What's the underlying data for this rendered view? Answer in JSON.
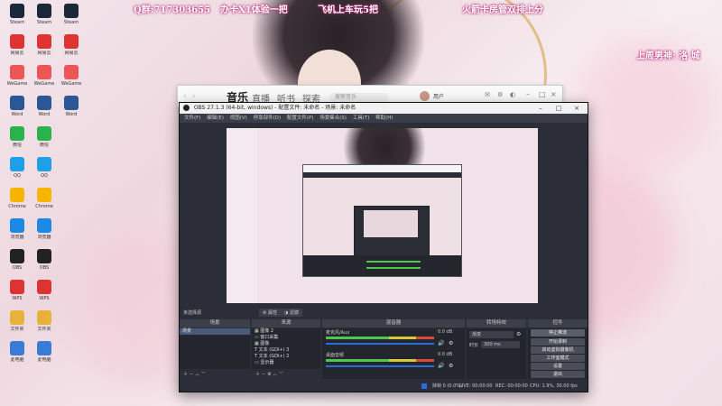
{
  "overlay": {
    "qq_group": "Q群:717303655",
    "promo_line1": "办卡X1体验一把",
    "promo_line2": "飞机上车玩5把",
    "promo_right": "火箭卡房管双排上分",
    "streamer": "上周男神: 洛 城"
  },
  "desktop_icons": [
    {
      "label": "Steam",
      "color": "#1b2838"
    },
    {
      "label": "网易云",
      "color": "#d33"
    },
    {
      "label": "WeGame",
      "color": "#e55"
    },
    {
      "label": "Word",
      "color": "#2b5797"
    },
    {
      "label": "微信",
      "color": "#2ab24c"
    },
    {
      "label": "QQ",
      "color": "#1ea0e8"
    },
    {
      "label": "Chrome",
      "color": "#f4b400"
    },
    {
      "label": "浏览器",
      "color": "#1e88e5"
    },
    {
      "label": "OBS",
      "color": "#222"
    },
    {
      "label": "WPS",
      "color": "#d33"
    },
    {
      "label": "文件夹",
      "color": "#e8b23a"
    },
    {
      "label": "此电脑",
      "color": "#3a7bd5"
    }
  ],
  "music_window": {
    "tabs": [
      "音乐",
      "直播",
      "听书",
      "探索"
    ],
    "search_placeholder": "搜索音乐",
    "user": "用户"
  },
  "obs": {
    "title": "OBS 27.1.3 (64-bit, windows) - 配置文件: 未命名 - 场景: 未命名",
    "menus": [
      "文件(F)",
      "编辑(E)",
      "视图(V)",
      "停靠部件(D)",
      "配置文件(P)",
      "场景集合(S)",
      "工具(T)",
      "帮助(H)"
    ],
    "no_source": "未选择源",
    "properties_btn": "属性",
    "filters_btn": "滤镜",
    "panels": {
      "scenes": "场景",
      "sources": "来源",
      "mixer": "混音器",
      "transitions": "转场特效",
      "controls": "控件"
    },
    "scenes": [
      "场景"
    ],
    "sources": [
      "图像 2",
      "窗口采集",
      "图像",
      "文本 (GDI+) 3",
      "文本 (GDI+) 2",
      "显示器"
    ],
    "mixer": [
      {
        "name": "麦克风/Aux",
        "db": "0.0 dB"
      },
      {
        "name": "桌面音频",
        "db": "0.0 dB"
      }
    ],
    "transitions": {
      "type": "渐变",
      "duration_label": "时长",
      "duration": "300 ms"
    },
    "controls": [
      "停止推流",
      "开始录制",
      "启动虚拟摄像机",
      "工作室模式",
      "设置",
      "退出"
    ],
    "status": {
      "dropped": "掉帧 0 (0.0%)",
      "live": "LIVE: 00:00:00",
      "rec": "REC: 00:00:00",
      "cpu": "CPU: 1.9%, 30.00 fps",
      "kbps": "kb/s"
    }
  },
  "colors": {
    "obs_bg": "#2b2e38",
    "panel_bg": "#24262e",
    "meter_green": "#4fc74f",
    "meter_yellow": "#d8c93a",
    "meter_red": "#d84a3a",
    "accent_blue": "#2a6be0"
  }
}
